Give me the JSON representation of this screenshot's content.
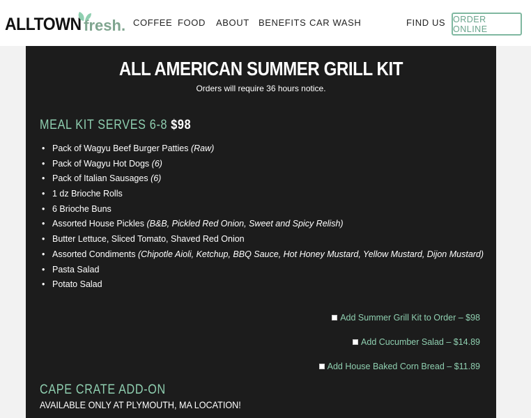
{
  "brand": {
    "logo_main": "ALLTOWN",
    "logo_sub": "fresh."
  },
  "nav": {
    "items": [
      "COFFEE",
      "FOOD",
      "ABOUT",
      "BENEFITS",
      "CAR WASH"
    ],
    "find_us": "FIND US",
    "order_online": "ORDER ONLINE"
  },
  "colors": {
    "accent": "#8fcfb0",
    "panel": "#1c1c1c",
    "header": "#ffffff"
  },
  "kit": {
    "title": "ALL AMERICAN SUMMER GRILL KIT",
    "notice": "Orders will require 36 hours notice.",
    "section_label": "MEAL KIT SERVES 6-8",
    "section_price": "$98",
    "items": [
      {
        "text": "Pack of Wagyu Beef Burger Patties ",
        "note": "(Raw)"
      },
      {
        "text": "Pack of Wagyu Hot Dogs ",
        "note": "(6)"
      },
      {
        "text": "Pack of Italian Sausages ",
        "note": "(6)"
      },
      {
        "text": "1 dz Brioche Rolls",
        "note": ""
      },
      {
        "text": "6 Brioche Buns",
        "note": ""
      },
      {
        "text": "Assorted House Pickles ",
        "note": "(B&B, Pickled Red Onion, Sweet and Spicy Relish)"
      },
      {
        "text": "Butter Lettuce, Sliced Tomato, Shaved Red Onion",
        "note": ""
      },
      {
        "text": "Assorted Condiments ",
        "note": "(Chipotle Aioli, Ketchup, BBQ Sauce, Hot Honey Mustard, Yellow Mustard, Dijon Mustard)"
      },
      {
        "text": "Pasta Salad",
        "note": ""
      },
      {
        "text": "Potato Salad",
        "note": ""
      }
    ],
    "addons": [
      {
        "label": "Add Summer Grill Kit to Order – $98"
      },
      {
        "label": "Add Cucumber Salad – $14.89"
      },
      {
        "label": "Add House Baked Corn Bread – $11.89"
      }
    ]
  },
  "crate": {
    "heading": "CAPE CRATE ADD-ON",
    "subheading": "AVAILABLE ONLY AT PLYMOUTH, MA LOCATION!"
  }
}
